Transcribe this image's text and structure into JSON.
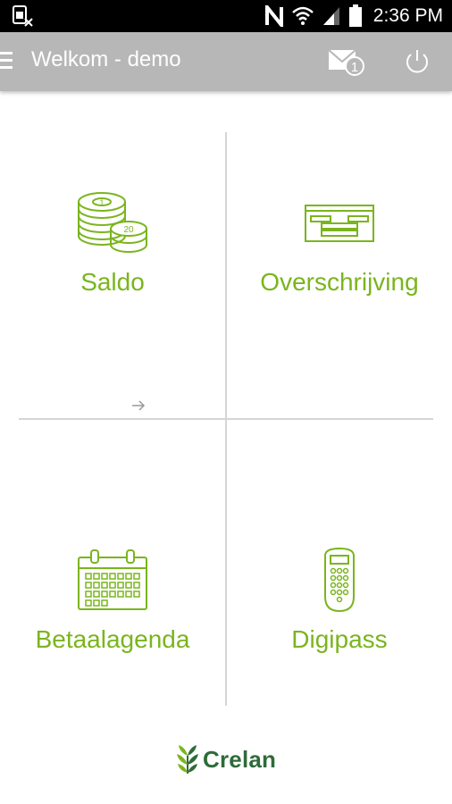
{
  "status_bar": {
    "time": "2:36 PM",
    "icons": [
      "sim-x-icon",
      "nfc-icon",
      "wifi-icon",
      "signal-icon",
      "battery-icon"
    ]
  },
  "app_bar": {
    "title": "Welkom - demo",
    "mail_badge": "1"
  },
  "tiles": [
    {
      "label": "Saldo",
      "icon": "coins-icon"
    },
    {
      "label": "Overschrijving",
      "icon": "transfer-form-icon"
    },
    {
      "label": "Betaalagenda",
      "icon": "calendar-icon"
    },
    {
      "label": "Digipass",
      "icon": "digipass-icon"
    }
  ],
  "footer": {
    "brand": "Crelan"
  },
  "colors": {
    "accent": "#7ab51d",
    "appbar": "#b7b7b7",
    "divider": "#d6d6d6",
    "brand": "#2f6b3a"
  }
}
